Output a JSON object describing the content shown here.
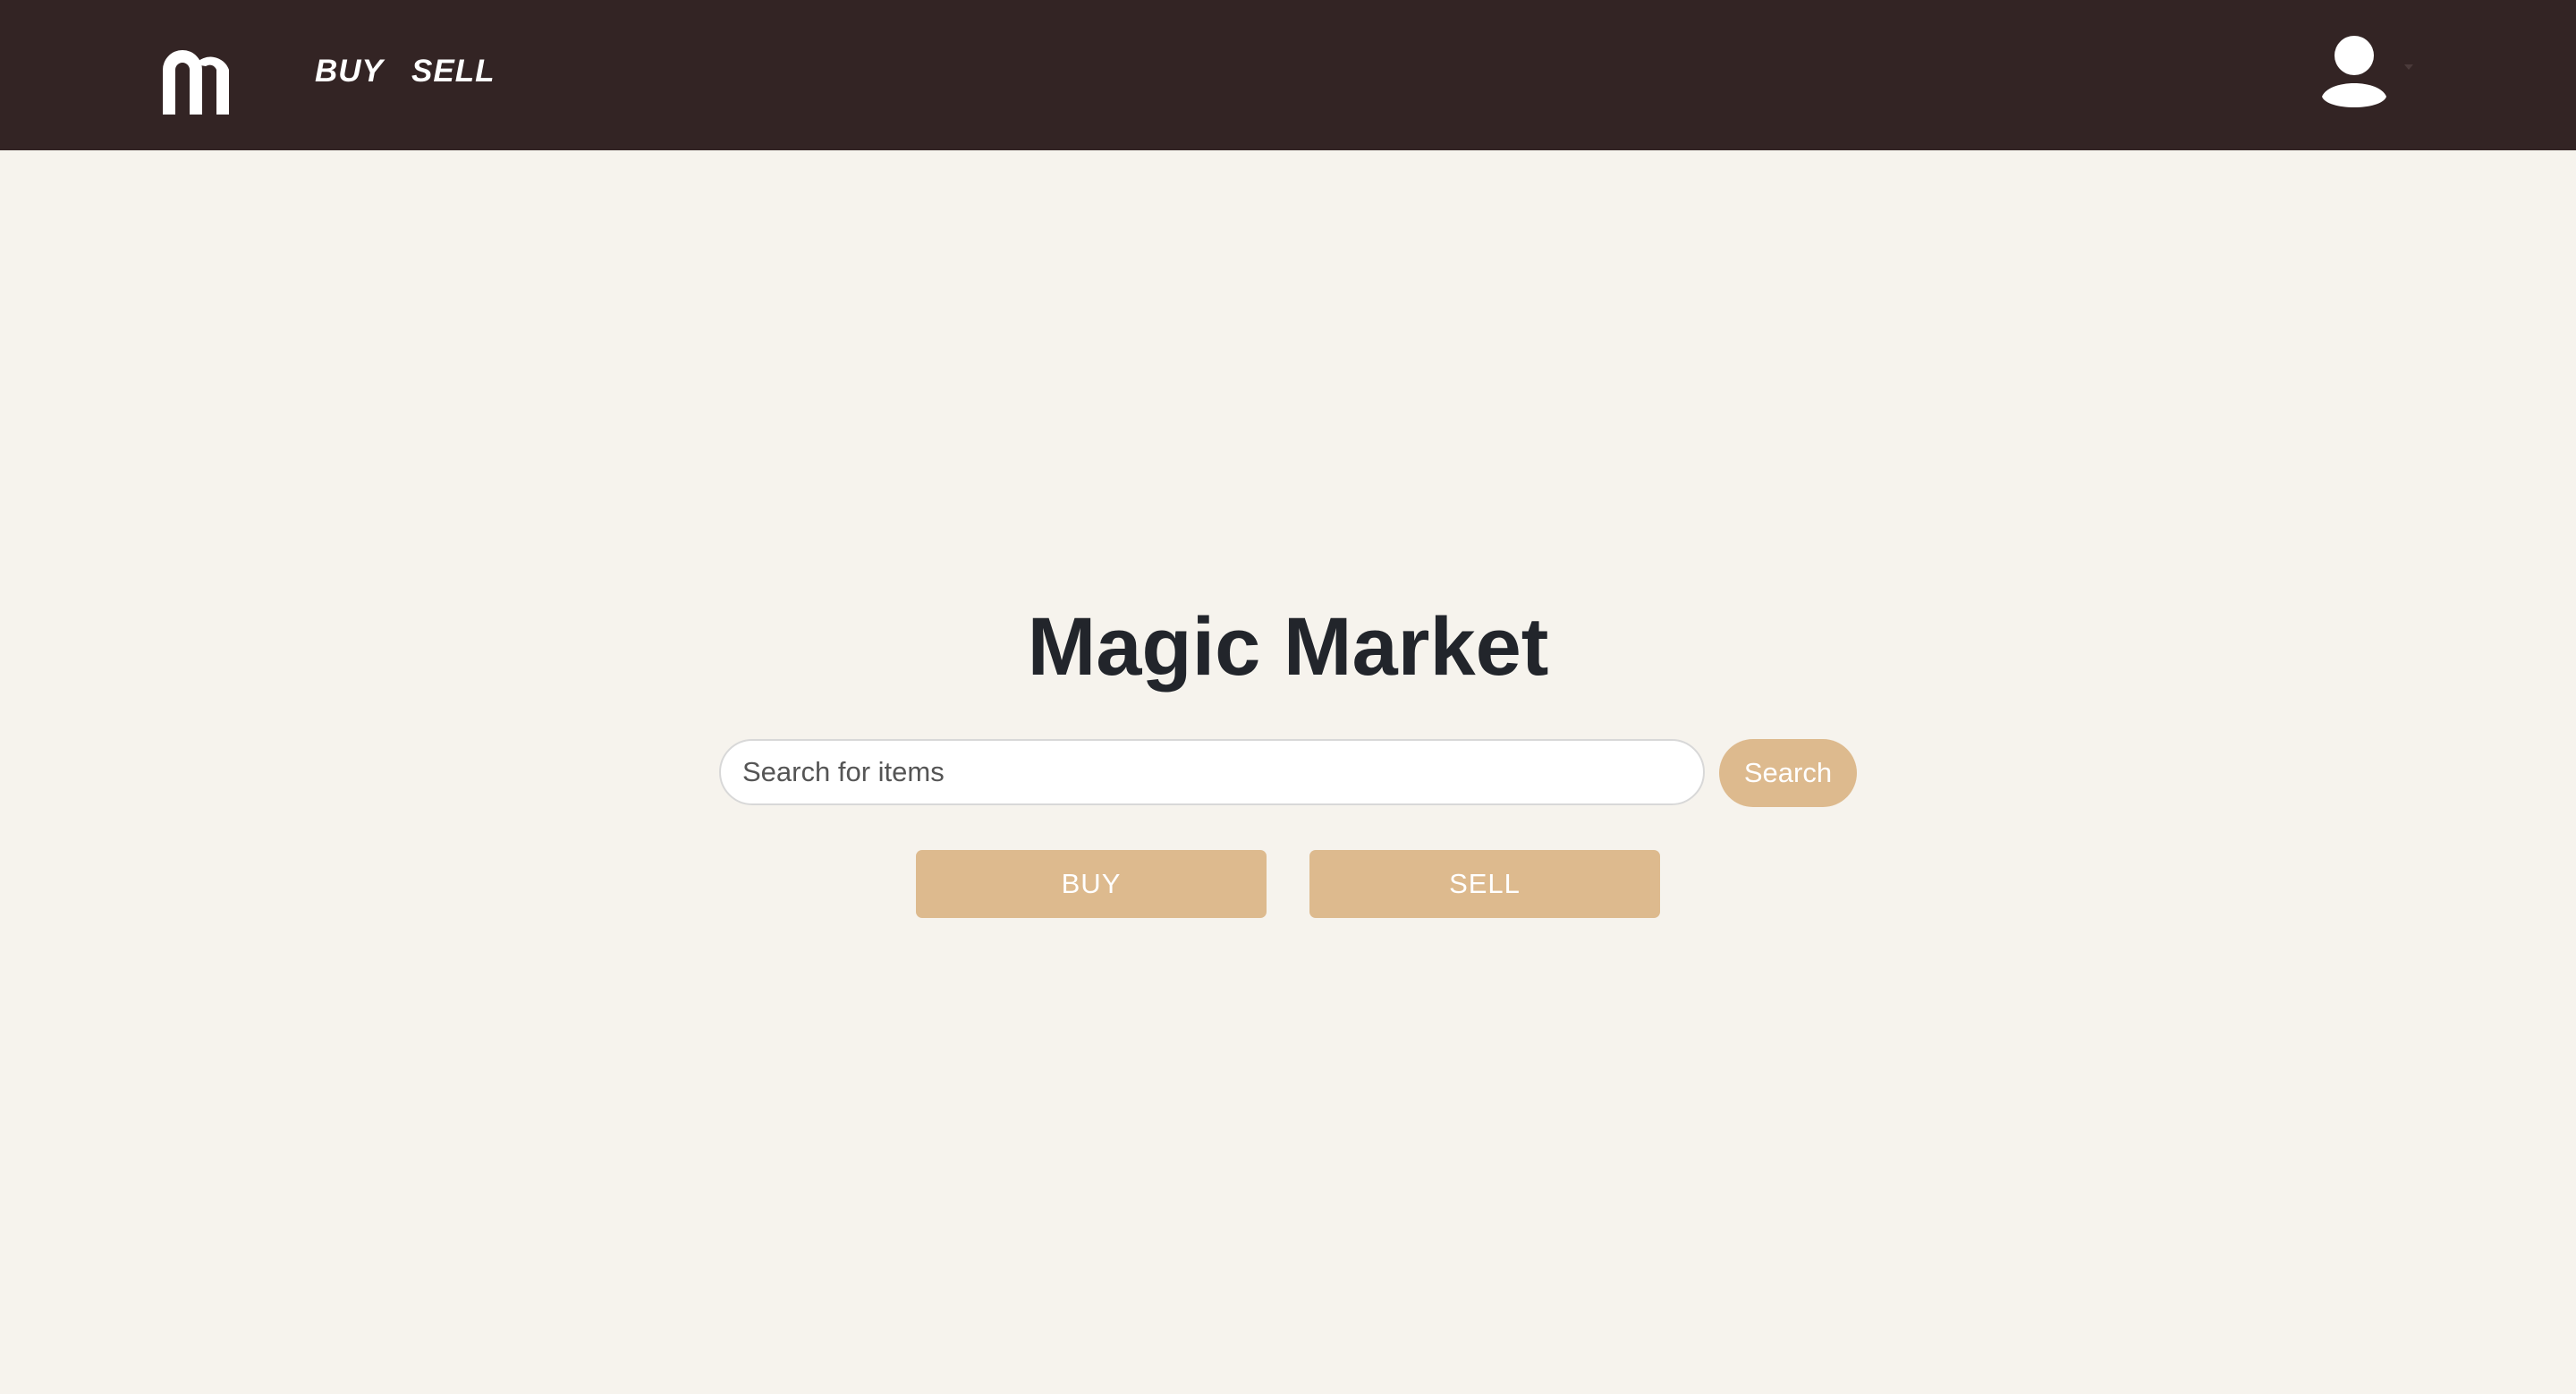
{
  "app": {
    "logo_icon": "magic-market-m-logo",
    "colors": {
      "navbar": "#332424",
      "background": "#f6f3ed",
      "accent": "#ddba8e",
      "title": "#22252b"
    }
  },
  "nav": {
    "links": [
      {
        "label": "BUY"
      },
      {
        "label": "SELL"
      }
    ],
    "user_icon": "user-avatar-icon"
  },
  "main": {
    "title": "Magic Market",
    "search": {
      "placeholder": "Search for items",
      "value": "",
      "button_label": "Search"
    },
    "actions": {
      "buy_label": "BUY",
      "sell_label": "SELL"
    }
  }
}
